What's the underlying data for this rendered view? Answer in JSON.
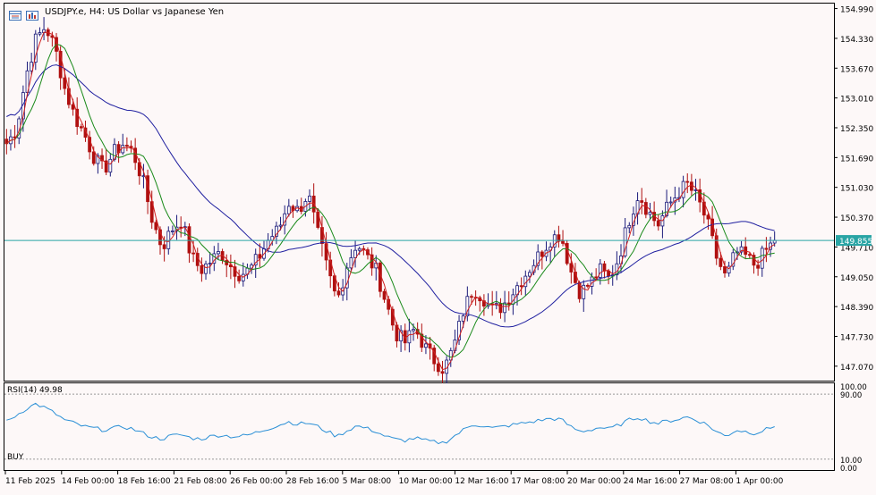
{
  "header": {
    "symbol_title": "USDJPY.e, H4:  US Dollar vs Japanese Yen",
    "icons": [
      "chart-window-icon",
      "bar-chart-icon"
    ]
  },
  "colors": {
    "background": "#fdf8f8",
    "bull_candle": "#1a1a7a",
    "bear_candle": "#b01010",
    "fast_ma": "#d02020",
    "mid_ma": "#1a8a1a",
    "slow_ma": "#2020a0",
    "price_line": "#2aa5a5",
    "rsi_line": "#2a8fd6",
    "price_tag_bg": "#2aa5a5"
  },
  "price_axis": {
    "labels": [
      "154.990",
      "154.330",
      "153.670",
      "153.010",
      "152.350",
      "151.690",
      "151.030",
      "150.370",
      "149.710",
      "149.050",
      "148.390",
      "147.730",
      "147.070"
    ],
    "current_price": "149.855"
  },
  "rsi_panel": {
    "label": "RSI(14) 49.98",
    "signal": "BUY",
    "axis_labels": [
      "100.00",
      "90.00",
      "10.00",
      "0.00"
    ],
    "levels": [
      90,
      10
    ]
  },
  "time_axis": {
    "labels": [
      "11 Feb 2025",
      "14 Feb 00:00",
      "18 Feb 16:00",
      "21 Feb 08:00",
      "26 Feb 00:00",
      "28 Feb 16:00",
      "5 Mar 08:00",
      "10 Mar 00:00",
      "12 Mar 16:00",
      "17 Mar 08:00",
      "20 Mar 00:00",
      "24 Mar 16:00",
      "27 Mar 08:00",
      "1 Apr 00:00"
    ]
  },
  "chart_data": {
    "type": "candlestick",
    "symbol": "USDJPY.e",
    "timeframe": "H4",
    "ylim": [
      146.75,
      155.1
    ],
    "grid": false,
    "price_path": [
      152.0,
      152.3,
      153.5,
      154.3,
      154.6,
      154.1,
      153.2,
      152.6,
      152.2,
      151.7,
      151.4,
      151.8,
      152.0,
      151.8,
      151.2,
      150.3,
      149.7,
      150.1,
      150.3,
      149.5,
      149.2,
      149.4,
      149.6,
      149.3,
      149.1,
      149.2,
      149.5,
      149.9,
      150.1,
      150.7,
      150.5,
      150.9,
      150.0,
      149.2,
      148.5,
      149.3,
      149.8,
      149.5,
      149.2,
      148.5,
      147.8,
      147.6,
      147.9,
      147.5,
      147.2,
      147.0,
      147.5,
      148.3,
      148.8,
      148.6,
      148.3,
      148.4,
      148.7,
      149.0,
      149.3,
      149.6,
      149.9,
      150.0,
      149.2,
      148.7,
      148.9,
      149.2,
      149.0,
      149.5,
      150.3,
      150.9,
      150.5,
      150.2,
      150.6,
      150.9,
      151.1,
      150.8,
      150.3,
      149.5,
      149.0,
      149.6,
      149.5,
      149.3,
      149.6,
      149.85
    ],
    "rsi_path": [
      56,
      64,
      72,
      78,
      73,
      66,
      58,
      54,
      50,
      48,
      46,
      48,
      50,
      47,
      42,
      37,
      35,
      39,
      40,
      36,
      35,
      38,
      40,
      38,
      38,
      40,
      44,
      48,
      52,
      56,
      53,
      55,
      50,
      44,
      38,
      45,
      51,
      48,
      44,
      38,
      34,
      33,
      36,
      33,
      31,
      30,
      38,
      46,
      53,
      51,
      48,
      50,
      52,
      54,
      56,
      58,
      60,
      59,
      50,
      44,
      46,
      49,
      47,
      52,
      58,
      62,
      57,
      54,
      57,
      59,
      62,
      58,
      53,
      44,
      38,
      46,
      44,
      42,
      46,
      49.98
    ]
  }
}
